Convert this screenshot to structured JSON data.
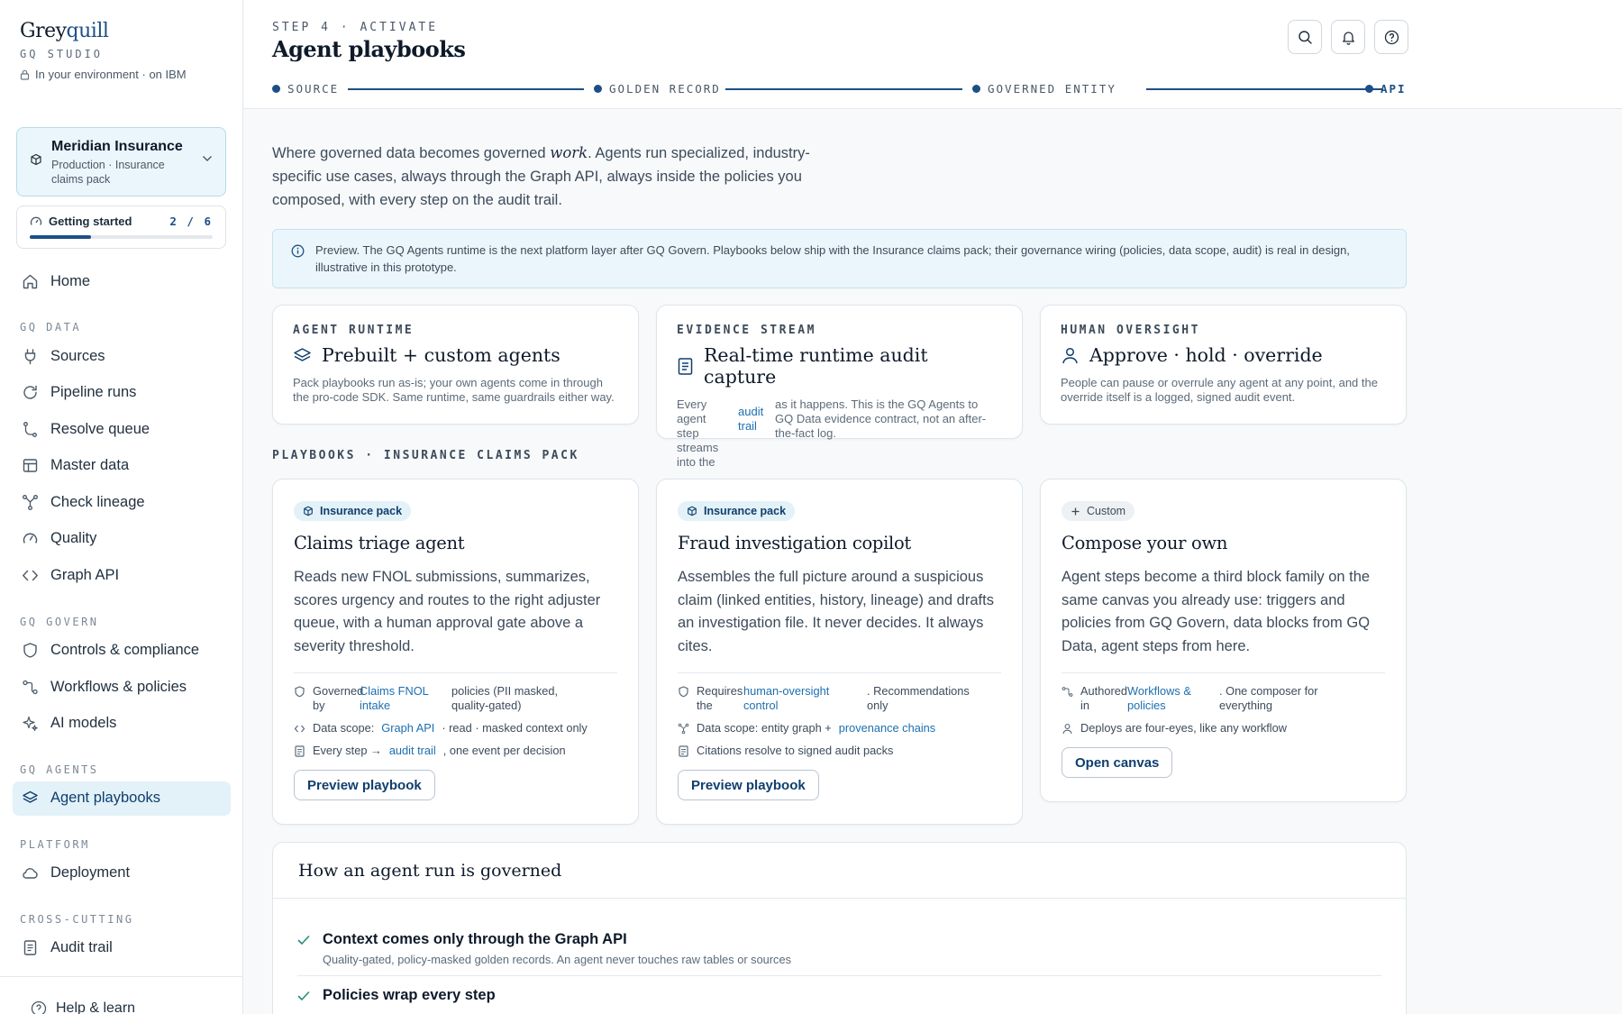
{
  "brand": {
    "name_a": "Grey",
    "name_b": "quill",
    "sub": "GQ STUDIO",
    "env": "In your environment · on IBM"
  },
  "org": {
    "name": "Meridian Insurance",
    "sub": "Production · Insurance claims pack"
  },
  "getting_started": {
    "label": "Getting started",
    "count": "2 / 6",
    "done": 2,
    "total": 6
  },
  "nav": {
    "home": "Home",
    "sec_data": "GQ DATA",
    "sources": "Sources",
    "pipeline_runs": "Pipeline runs",
    "resolve_queue": "Resolve queue",
    "master_data": "Master data",
    "check_lineage": "Check lineage",
    "quality": "Quality",
    "graph_api": "Graph API",
    "sec_govern": "GQ GOVERN",
    "controls": "Controls & compliance",
    "workflows": "Workflows & policies",
    "ai_models": "AI models",
    "sec_agents": "GQ AGENTS",
    "agent_playbooks": "Agent playbooks",
    "sec_platform": "PLATFORM",
    "deployment": "Deployment",
    "sec_cross": "CROSS-CUTTING",
    "audit_trail": "Audit trail",
    "help": "Help & learn"
  },
  "header": {
    "step": "STEP 4 · ACTIVATE",
    "title": "Agent playbooks",
    "stepper": [
      "SOURCE",
      "GOLDEN RECORD",
      "GOVERNED ENTITY",
      "API"
    ]
  },
  "intro": {
    "before": "Where governed data becomes governed ",
    "em": "work",
    "after": ". Agents run specialized, industry-specific use cases, always through the Graph API, always inside the policies you composed, with every step on the audit trail."
  },
  "notice": "Preview. The GQ Agents runtime is the next platform layer after GQ Govern. Playbooks below ship with the Insurance claims pack; their governance wiring (policies, data scope, audit) is real in design, illustrative in this prototype.",
  "features": [
    {
      "eyebrow": "AGENT RUNTIME",
      "title": "Prebuilt + custom agents",
      "desc": "Pack playbooks run as-is; your own agents come in through the pro-code SDK. Same runtime, same guardrails either way."
    },
    {
      "eyebrow": "EVIDENCE STREAM",
      "title": "Real-time runtime audit capture",
      "desc_a": "Every agent step streams into the",
      "desc_link": "audit trail",
      "desc_b": "as it happens. This is the GQ Agents to GQ Data evidence contract, not an after-the-fact log."
    },
    {
      "eyebrow": "HUMAN OVERSIGHT",
      "title": "Approve · hold · override",
      "desc": "People can pause or overrule any agent at any point, and the override itself is a logged, signed audit event."
    }
  ],
  "section_label": "PLAYBOOKS · INSURANCE CLAIMS PACK",
  "playbooks": [
    {
      "badge": "Insurance pack",
      "title": "Claims triage agent",
      "desc": "Reads new FNOL submissions, summarizes, scores urgency and routes to the right adjuster queue, with a human approval gate above a severity threshold.",
      "m1_a": "Governed by",
      "m1_link": "Claims FNOL intake",
      "m1_b": "policies (PII masked, quality-gated)",
      "m2_a": "Data scope:",
      "m2_link": "Graph API",
      "m2_b": "· read · masked context only",
      "m3_a": "Every step →",
      "m3_link": "audit trail",
      "m3_b": ", one event per decision",
      "button": "Preview playbook"
    },
    {
      "badge": "Insurance pack",
      "title": "Fraud investigation copilot",
      "desc": "Assembles the full picture around a suspicious claim (linked entities, history, lineage) and drafts an investigation file. It never decides. It always cites.",
      "m1_a": "Requires the",
      "m1_link": "human-oversight control",
      "m1_b": ". Recommendations only",
      "m2_a": "Data scope: entity graph +",
      "m2_link": "provenance chains",
      "m3": "Citations resolve to signed audit packs",
      "button": "Preview playbook"
    },
    {
      "badge": "Custom",
      "title": "Compose your own",
      "desc": "Agent steps become a third block family on the same canvas you already use: triggers and policies from GQ Govern, data blocks from GQ Data, agent steps from here.",
      "m1_a": "Authored in",
      "m1_link": "Workflows & policies",
      "m1_b": ". One composer for everything",
      "m2": "Deploys are four-eyes, like any workflow",
      "button": "Open canvas"
    }
  ],
  "governed": {
    "title": "How an agent run is governed",
    "items": [
      {
        "title": "Context comes only through the Graph API",
        "sub": "Quality-gated, policy-masked golden records. An agent never touches raw tables or sources"
      },
      {
        "title": "Policies wrap every step",
        "sub": ""
      }
    ]
  },
  "colors": {
    "accent": "#1c4f86",
    "link": "#1c6fb0",
    "info_bg": "#eaf6fb"
  }
}
